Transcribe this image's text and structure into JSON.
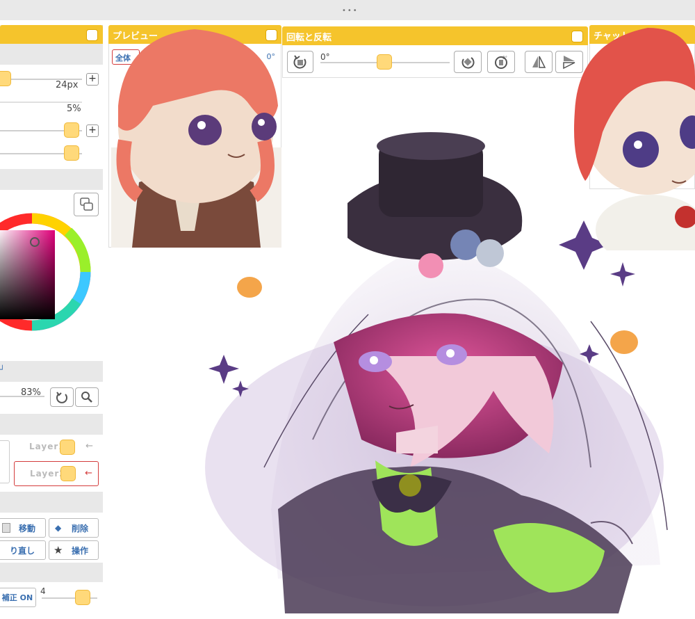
{
  "topbar": {
    "dots": "•••"
  },
  "preview_panel": {
    "title": "プレビュー",
    "button_partial": "全体",
    "angle_partial": "0°"
  },
  "rotate_panel": {
    "title": "回転と反転",
    "angle": "0°"
  },
  "chat_panel": {
    "title": "チャット"
  },
  "brush": {
    "size": "24px",
    "opacity": "5%"
  },
  "zoom": {
    "value": "83%"
  },
  "layers": [
    {
      "name": "Layer1",
      "selected": false
    },
    {
      "name": "Layer2",
      "selected": true
    }
  ],
  "actions": {
    "move": "移動",
    "delete": "削除",
    "redo": "り直し",
    "operate": "操作"
  },
  "stabilizer": {
    "label": "補正 ON",
    "value": "4"
  },
  "colors": {
    "accent": "#f5c42c",
    "knob": "#ffd97a",
    "selected_border": "#d43b3b"
  }
}
